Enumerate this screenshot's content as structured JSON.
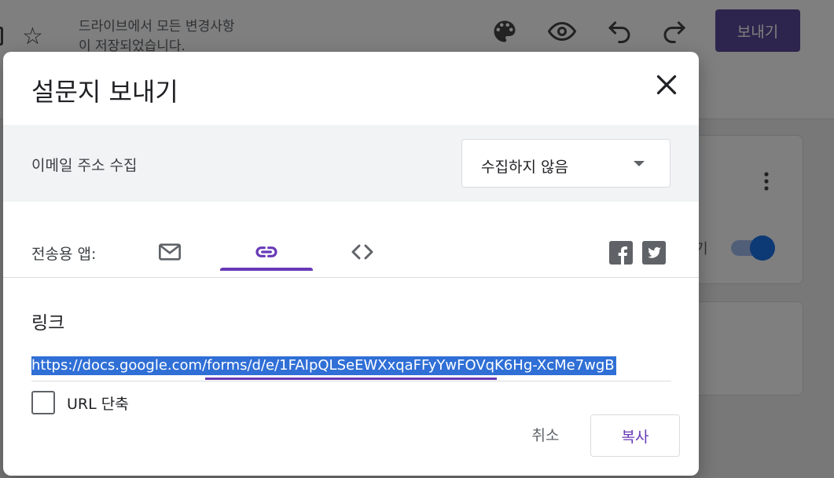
{
  "background": {
    "save_status": "드라이브에서 모든 변경사항\n이 저장되었습니다.",
    "toolbar_icons": [
      "palette-icon",
      "eye-icon",
      "undo-icon",
      "redo-icon"
    ],
    "send_button_label": "보내기",
    "card_link_fragment": "기",
    "card_toggle_label_fragment": "기"
  },
  "dialog": {
    "title": "설문지 보내기",
    "email_collection": {
      "label": "이메일 주소 수집",
      "selected": "수집하지 않음"
    },
    "send_via": {
      "label": "전송용 앱:",
      "tabs": [
        {
          "icon": "mail-icon",
          "active": false
        },
        {
          "icon": "link-icon",
          "active": true
        },
        {
          "icon": "code-icon",
          "active": false
        }
      ],
      "social": [
        "facebook-icon",
        "twitter-icon"
      ]
    },
    "link_section": {
      "heading": "링크",
      "url": "https://docs.google.com/forms/d/e/1FAIpQLSeEWXxqaFFyYwFOVqK6Hg-XcMe7wgB",
      "shorten_label": "URL 단축",
      "shorten_checked": false
    },
    "actions": {
      "cancel_label": "취소",
      "copy_label": "복사"
    }
  },
  "colors": {
    "accent": "#673ab7",
    "selection": "#2f6fd6",
    "icon": "#5f6368"
  }
}
